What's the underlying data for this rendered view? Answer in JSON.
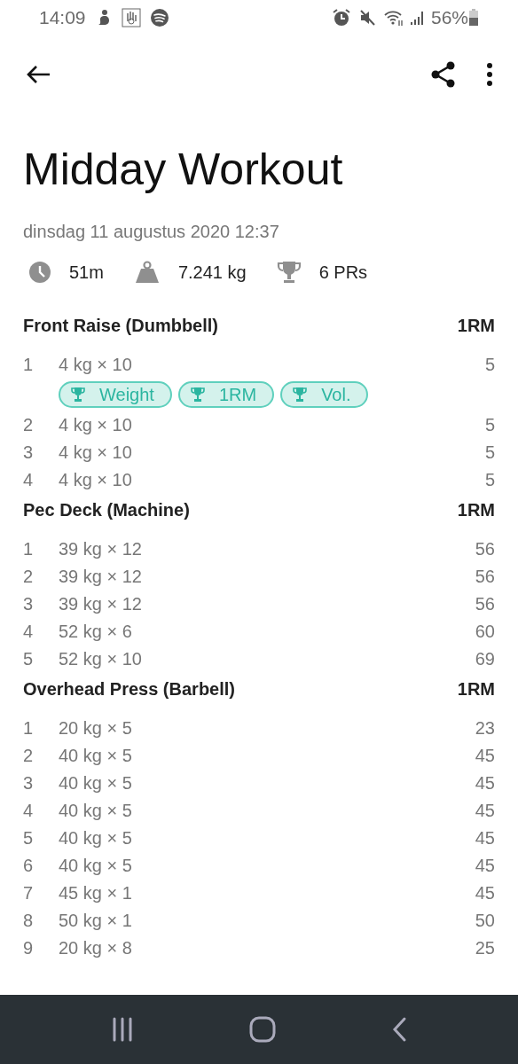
{
  "status_bar": {
    "time": "14:09",
    "battery": "56%"
  },
  "workout": {
    "title": "Midday Workout",
    "date": "dinsdag 11 augustus 2020 12:37",
    "stats": [
      {
        "kind": "duration",
        "value": "51m"
      },
      {
        "kind": "volume",
        "value": "7.241 kg"
      },
      {
        "kind": "prs",
        "value": "6 PRs"
      }
    ]
  },
  "exercises": [
    {
      "name": "Front Raise (Dumbbell)",
      "column": "1RM",
      "sets": [
        {
          "index": "1",
          "set": "4 kg × 10",
          "value": "5",
          "prs": [
            "Weight",
            "1RM",
            "Vol."
          ]
        },
        {
          "index": "2",
          "set": "4 kg × 10",
          "value": "5"
        },
        {
          "index": "3",
          "set": "4 kg × 10",
          "value": "5"
        },
        {
          "index": "4",
          "set": "4 kg × 10",
          "value": "5"
        }
      ]
    },
    {
      "name": "Pec Deck (Machine)",
      "column": "1RM",
      "sets": [
        {
          "index": "1",
          "set": "39 kg × 12",
          "value": "56"
        },
        {
          "index": "2",
          "set": "39 kg × 12",
          "value": "56"
        },
        {
          "index": "3",
          "set": "39 kg × 12",
          "value": "56"
        },
        {
          "index": "4",
          "set": "52 kg × 6",
          "value": "60"
        },
        {
          "index": "5",
          "set": "52 kg × 10",
          "value": "69"
        }
      ]
    },
    {
      "name": "Overhead Press (Barbell)",
      "column": "1RM",
      "sets": [
        {
          "index": "1",
          "set": "20 kg × 5",
          "value": "23"
        },
        {
          "index": "2",
          "set": "40 kg × 5",
          "value": "45"
        },
        {
          "index": "3",
          "set": "40 kg × 5",
          "value": "45"
        },
        {
          "index": "4",
          "set": "40 kg × 5",
          "value": "45"
        },
        {
          "index": "5",
          "set": "40 kg × 5",
          "value": "45"
        },
        {
          "index": "6",
          "set": "40 kg × 5",
          "value": "45"
        },
        {
          "index": "7",
          "set": "45 kg × 1",
          "value": "45"
        },
        {
          "index": "8",
          "set": "50 kg × 1",
          "value": "50"
        },
        {
          "index": "9",
          "set": "20 kg × 8",
          "value": "25"
        }
      ]
    }
  ]
}
